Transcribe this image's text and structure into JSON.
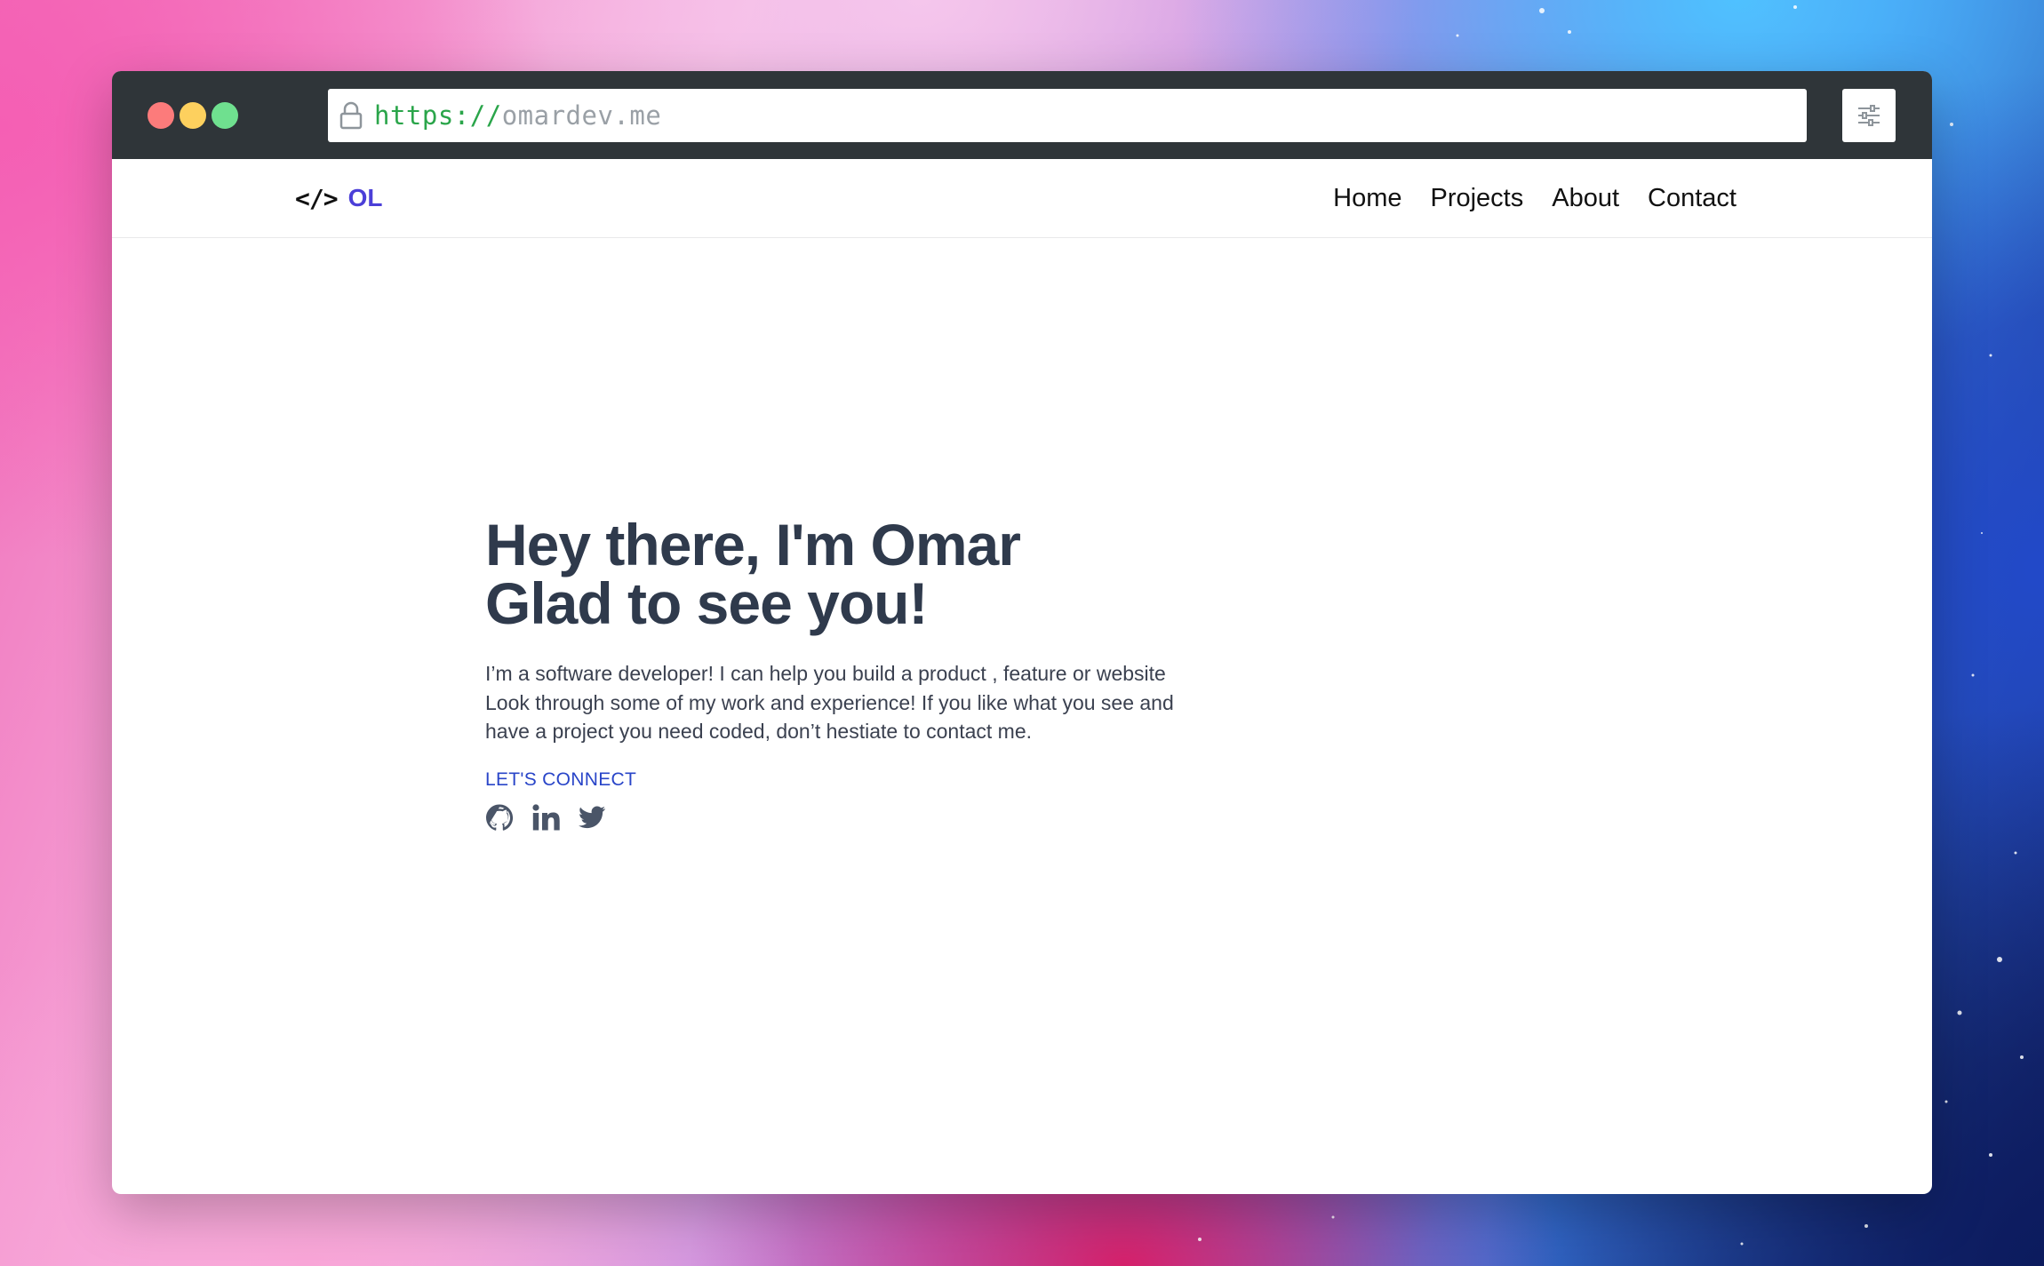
{
  "browser": {
    "url_protocol": "https://",
    "url_host": "omardev.me"
  },
  "navbar": {
    "logo_code": "</>",
    "logo_text": "OL",
    "links": [
      "Home",
      "Projects",
      "About",
      "Contact"
    ]
  },
  "hero": {
    "title_line1": "Hey there, I'm Omar",
    "title_line2": "Glad to see you!",
    "description": "I’m a software developer! I can help you build a product , feature or website Look through some of my work and experience! If you like what you see and have a project you need coded, don’t hestiate to contact me.",
    "connect_label": "LET'S CONNECT",
    "social_icons": [
      "github-icon",
      "linkedin-icon",
      "twitter-icon"
    ]
  },
  "colors": {
    "title": "#2f3a4c",
    "accent": "#2945c8",
    "logo": "#4b3fd8",
    "url_protocol": "#2aa54a",
    "titlebar": "#2f3539"
  }
}
